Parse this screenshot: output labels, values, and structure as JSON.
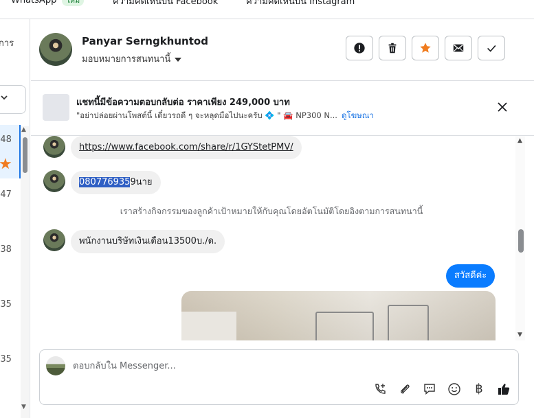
{
  "tabs": [
    {
      "label": "WhatsApp",
      "badge": "ใหม่"
    },
    {
      "label": "ความคิดเห็นบน Facebook"
    },
    {
      "label": "ความคิดเห็นบน Instagram"
    }
  ],
  "left_panel": {
    "partial_text": "การ",
    "times": [
      ":48",
      ":47",
      ":38",
      ":35",
      ":35"
    ]
  },
  "header": {
    "contact_name": "Panyar Serngkhuntod",
    "assign_label": "มอบหมายการสนทนานี้",
    "buttons": [
      "report-icon",
      "trash-icon",
      "star-icon",
      "mail-icon",
      "check-icon"
    ]
  },
  "ad_banner": {
    "title": "แชทนี้มีข้อความตอบกลับต่อ ราคาเพียง 249,000 บาท",
    "subtitle": "\"อย่าปล่อยผ่านโพสต์นี้ เดี๋ยวรถดี ๆ จะหลุดมือไปนะครับ 💠 \" 🚘 NP300 N...",
    "link": "ดูโฆษณา"
  },
  "messages": {
    "link_message": "https://www.facebook.com/share/r/1GYStetPMV/",
    "phone_selected": "080776935",
    "phone_rest": "9นาย",
    "system_note": "เราสร้างกิจกรรมของลูกค้าเป้าหมายให้กับคุณโดยอัตโนมัติโดยอิงตามการสนทนานี้",
    "salary_message": "พนักงานบริษัทเงินเดือน13500บ./ด.",
    "outgoing_greeting": "สวัสดีค่ะ"
  },
  "composer": {
    "placeholder": "ตอบกลับใน Messenger...",
    "tools": [
      "call-add-icon",
      "attach-icon",
      "saved-replies-icon",
      "emoji-icon",
      "baht-icon",
      "like-icon"
    ],
    "baht_symbol": "฿"
  },
  "colors": {
    "accent": "#0a7cff",
    "star": "#f07c1f",
    "selection": "#2f5fc4"
  }
}
